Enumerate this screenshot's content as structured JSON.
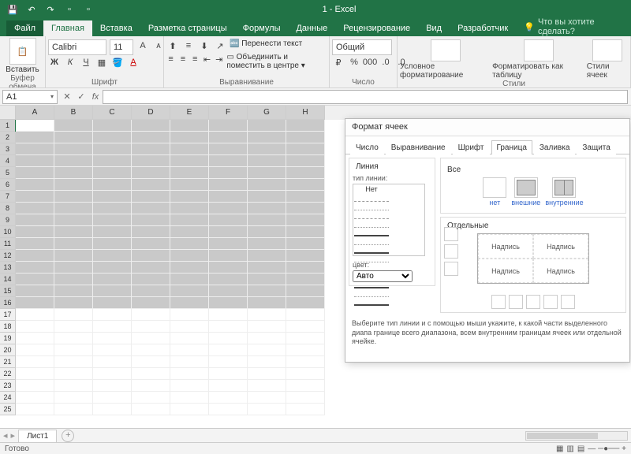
{
  "title": "1 - Excel",
  "tabs": {
    "file": "Файл",
    "home": "Главная",
    "insert": "Вставка",
    "layout": "Разметка страницы",
    "formulas": "Формулы",
    "data": "Данные",
    "review": "Рецензирование",
    "view": "Вид",
    "dev": "Разработчик"
  },
  "tellme": "Что вы хотите сделать?",
  "ribbon": {
    "paste": "Вставить",
    "clipboard_lbl": "Буфер обмена",
    "font_name": "Calibri",
    "font_size": "11",
    "font_lbl": "Шрифт",
    "wrap": "Перенести текст",
    "merge": "Объединить и поместить в центре",
    "align_lbl": "Выравнивание",
    "numfmt": "Общий",
    "number_lbl": "Число",
    "cond": "Условное форматирование",
    "table": "Форматировать как таблицу",
    "styles": "Стили ячеек",
    "styles_lbl": "Стили"
  },
  "namebox": "A1",
  "columns": [
    "A",
    "B",
    "C",
    "D",
    "E",
    "F",
    "G",
    "H"
  ],
  "rows": 25,
  "selected_rows": 16,
  "selected_cols": 8,
  "sheet": "Лист1",
  "status": "Готово",
  "dialog": {
    "title": "Формат ячеек",
    "tabs": {
      "number": "Число",
      "align": "Выравнивание",
      "font": "Шрифт",
      "border": "Граница",
      "fill": "Заливка",
      "protect": "Защита"
    },
    "line": "Линия",
    "linetype": "тип линии:",
    "none": "Нет",
    "color": "цвет:",
    "auto": "Авто",
    "all": "Все",
    "presets": {
      "none": "нет",
      "outer": "внешние",
      "inner": "внутренние"
    },
    "separate": "Отдельные",
    "sample": "Надпись",
    "help": "Выберите тип линии и с помощью мыши укажите, к какой части выделенного диапа границе всего диапазона, всем внутренним границам ячеек или отдельной ячейке."
  }
}
